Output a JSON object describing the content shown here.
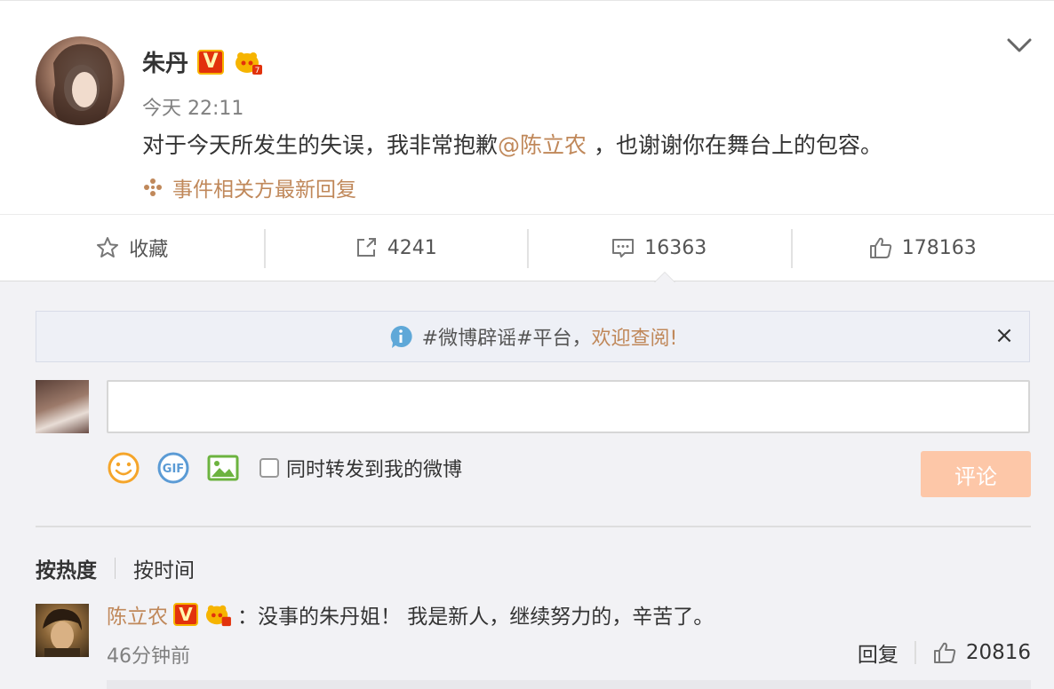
{
  "post": {
    "author_name": "朱丹",
    "verified_badge": "V",
    "timestamp": "今天 22:11",
    "content_before": "对于今天所发生的失误，我非常抱歉",
    "mention": "@陈立农",
    "content_after": " ，也谢谢你在舞台上的包容。",
    "reply_note": "事件相关方最新回复",
    "menu_icon": "chevron-down-icon"
  },
  "actions": {
    "favorite_label": "收藏",
    "repost_count": "4241",
    "comment_count": "16363",
    "like_count": "178163"
  },
  "notice": {
    "text": "#微博辟谣#平台，",
    "link": "欢迎查阅!",
    "close": "×"
  },
  "composer": {
    "input_value": "",
    "repost_label": "同时转发到我的微博",
    "submit_label": "评论"
  },
  "sort": {
    "by_hot": "按热度",
    "by_time": "按时间"
  },
  "comment": {
    "author": "陈立农",
    "verified_badge": "V",
    "text": "：没事的朱丹姐！ 我是新人，继续努力的，辛苦了。",
    "time": "46分钟前",
    "reply_label": "回复",
    "like_count": "20816"
  },
  "colors": {
    "accent": "#c0885a",
    "submit_bg": "#fdc7a8",
    "verified_red": "#e2320c",
    "page_bg": "#f2f2f5"
  }
}
